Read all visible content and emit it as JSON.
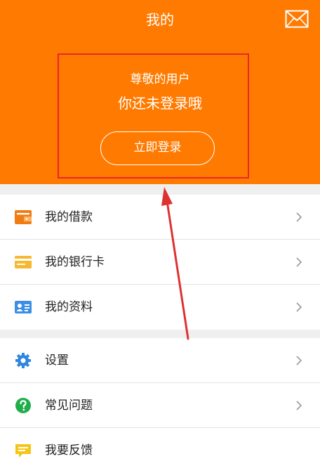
{
  "header": {
    "title": "我的",
    "greeting": "尊敬的用户",
    "not_logged_in": "你还未登录哦",
    "login_button": "立即登录"
  },
  "menu_group_1": [
    {
      "label": "我的借款",
      "icon": "wallet-icon"
    },
    {
      "label": "我的银行卡",
      "icon": "bank-card-icon"
    },
    {
      "label": "我的资料",
      "icon": "profile-card-icon"
    }
  ],
  "menu_group_2": [
    {
      "label": "设置",
      "icon": "gear-icon"
    },
    {
      "label": "常见问题",
      "icon": "question-icon"
    },
    {
      "label": "我要反馈",
      "icon": "feedback-icon"
    }
  ],
  "colors": {
    "header_bg": "#ff7a00",
    "highlight_border": "#e8262c",
    "annotation_arrow": "#e03131",
    "page_bg": "#efefef"
  }
}
